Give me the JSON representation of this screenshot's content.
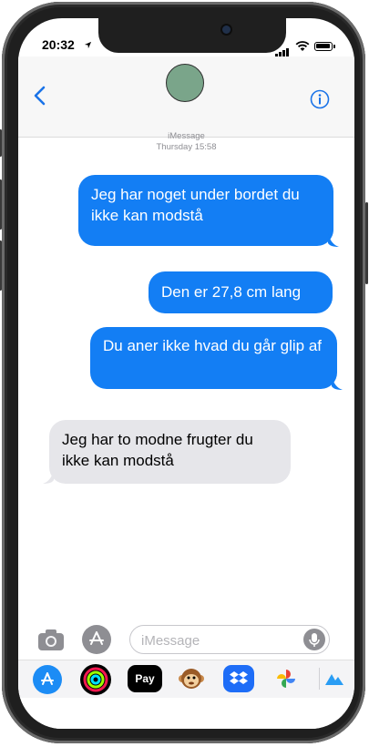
{
  "status": {
    "time": "20:32"
  },
  "header": {
    "back_icon": "chevron-left-icon",
    "info_icon": "info-icon",
    "avatar_color": "#7aa58a"
  },
  "thread": {
    "service": "iMessage",
    "timestamp": "Thursday 15:58",
    "messages": [
      {
        "direction": "outgoing",
        "text": "Jeg har noget under bordet du ikke kan modstå"
      },
      {
        "direction": "outgoing",
        "text": "Den er 27,8 cm lang"
      },
      {
        "direction": "outgoing",
        "text": "Du aner ikke hvad du går glip af"
      },
      {
        "direction": "incoming",
        "text": "Jeg har to modne frugter du ikke kan modstå"
      }
    ]
  },
  "composer": {
    "placeholder": "iMessage",
    "camera_icon": "camera-icon",
    "apps_icon": "app-store-icon",
    "mic_icon": "microphone-icon"
  },
  "app_strip": {
    "items": [
      {
        "name": "app-store-icon"
      },
      {
        "name": "activity-rings-icon"
      },
      {
        "name": "apple-pay-icon",
        "label": "Pay"
      },
      {
        "name": "animoji-monkey-icon"
      },
      {
        "name": "dropbox-icon"
      },
      {
        "name": "google-photos-icon"
      },
      {
        "name": "partial-app-icon"
      }
    ]
  },
  "colors": {
    "outgoing_bubble": "#137ef4",
    "incoming_bubble": "#e6e6ea",
    "accent": "#1a73e8"
  }
}
